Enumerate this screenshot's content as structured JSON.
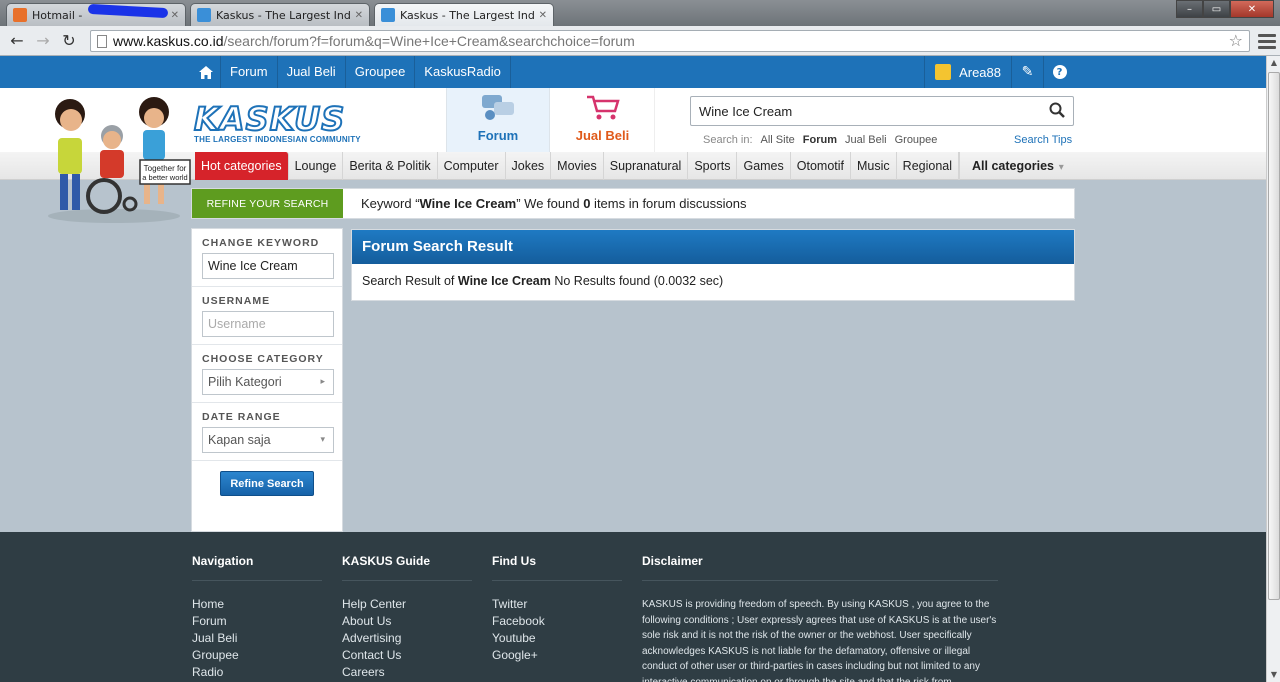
{
  "browser": {
    "tabs": [
      {
        "title": "Hotmail - ",
        "active": false,
        "favicon_color": "#e8702a"
      },
      {
        "title": "Kaskus - The Largest Indo",
        "active": false,
        "favicon_color": "#3a8fd8"
      },
      {
        "title": "Kaskus - The Largest Indo",
        "active": true,
        "favicon_color": "#3a8fd8"
      }
    ],
    "url_host": "www.kaskus.co.id",
    "url_path": "/search/forum?f=forum&q=Wine+Ice+Cream&searchchoice=forum",
    "window_buttons": {
      "minimize": "–",
      "maximize": "▭",
      "close": "✕"
    }
  },
  "topnav": {
    "items": [
      "Forum",
      "Jual Beli",
      "Groupee",
      "KaskusRadio"
    ],
    "username": "Area88"
  },
  "header": {
    "logo_text": "KASKUS",
    "logo_tagline": "THE LARGEST INDONESIAN COMMUNITY",
    "mode_forum": "Forum",
    "mode_jualbeli": "Jual Beli",
    "search_value": "Wine Ice Cream",
    "search_in_label": "Search in:",
    "search_in_options": [
      "All Site",
      "Forum",
      "Jual Beli",
      "Groupee"
    ],
    "search_in_selected": "Forum",
    "search_tips": "Search Tips",
    "mascot_sign": "Together for a better world"
  },
  "categories": {
    "hot": "Hot categories",
    "items": [
      "Lounge",
      "Berita & Politik",
      "Computer",
      "Jokes",
      "Movies",
      "Supranatural",
      "Sports",
      "Games",
      "Otomotif",
      "Music",
      "Regional"
    ],
    "all": "All categories"
  },
  "refine": {
    "tab_label": "REFINE YOUR SEARCH",
    "kw_prefix": "Keyword “",
    "keyword": "Wine Ice Cream",
    "kw_mid": "” We found ",
    "count": "0",
    "kw_suffix": " items in forum discussions"
  },
  "sidebar": {
    "change_keyword_label": "CHANGE KEYWORD",
    "keyword_value": "Wine Ice Cream",
    "username_label": "USERNAME",
    "username_placeholder": "Username",
    "category_label": "CHOOSE CATEGORY",
    "category_value": "Pilih Kategori",
    "date_label": "DATE RANGE",
    "date_value": "Kapan saja",
    "button": "Refine Search"
  },
  "results": {
    "title": "Forum Search Result",
    "prefix": "Search Result of ",
    "keyword": "Wine Ice Cream",
    "suffix": " No Results found (0.0032 sec)"
  },
  "footer": {
    "navigation": {
      "title": "Navigation",
      "links": [
        "Home",
        "Forum",
        "Jual Beli",
        "Groupee",
        "Radio"
      ]
    },
    "guide": {
      "title": "KASKUS Guide",
      "links": [
        "Help Center",
        "About Us",
        "Advertising",
        "Contact Us",
        "Careers"
      ]
    },
    "findus": {
      "title": "Find Us",
      "links": [
        "Twitter",
        "Facebook",
        "Youtube",
        "Google+"
      ]
    },
    "disclaimer": {
      "title": "Disclaimer",
      "text": "KASKUS is providing freedom of speech. By using KASKUS , you agree to the following conditions ; User expressly agrees that use of KASKUS is at the user's sole risk and it is not the risk of the owner or the webhost. User specifically acknowledges KASKUS is not liable for the defamatory, offensive or illegal conduct of other user or third-parties in cases including but not limited to any interactive communication on or through the site and that the risk from"
    }
  },
  "colors": {
    "brand_blue": "#1e72b8",
    "hot_red": "#d6232a",
    "refine_green": "#5e9c1f",
    "footer_bg": "#2f3d44"
  }
}
